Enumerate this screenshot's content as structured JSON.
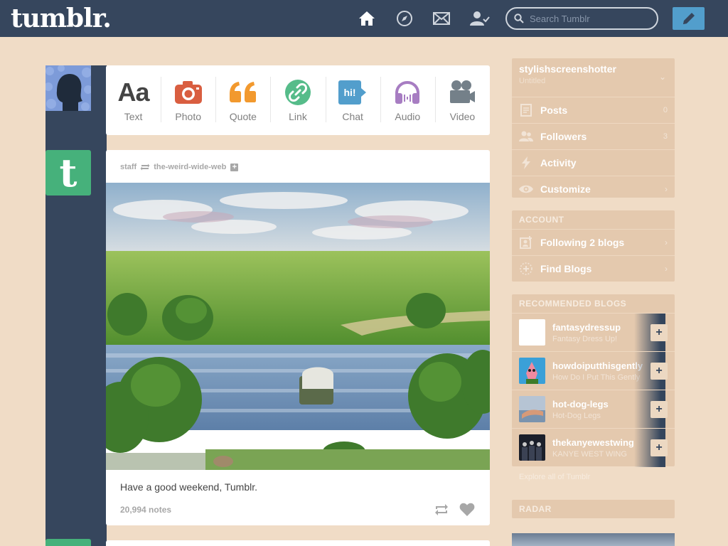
{
  "header": {
    "logo": "tumblr.",
    "search_placeholder": "Search Tumblr",
    "nav": [
      "home-icon",
      "explore-compass-icon",
      "inbox-envelope-icon",
      "account-icon"
    ],
    "compose_icon": "pencil-icon",
    "bg_color": "#36465d",
    "compose_color": "#529ecc"
  },
  "post_types": [
    {
      "label": "Text",
      "glyph": "Aa",
      "color": "#444444"
    },
    {
      "label": "Photo",
      "color": "#d95e40"
    },
    {
      "label": "Quote",
      "glyph": "“",
      "color": "#f2992e"
    },
    {
      "label": "Link",
      "color": "#56bc8a"
    },
    {
      "label": "Chat",
      "glyph": "hi!",
      "color": "#529ecc"
    },
    {
      "label": "Audio",
      "color": "#a77dc2"
    },
    {
      "label": "Video",
      "color": "#748089"
    }
  ],
  "post": {
    "author": "staff",
    "reblogged_from": "the-weird-wide-web",
    "caption": "Have a good weekend, Tumblr.",
    "notes": "20,994 notes"
  },
  "sidebar": {
    "account": {
      "name": "stylishscreenshotter",
      "subtitle": "Untitled"
    },
    "blog_rows": [
      {
        "label": "Posts",
        "count": "0",
        "icon": "posts-icon"
      },
      {
        "label": "Followers",
        "count": "3",
        "icon": "followers-icon"
      },
      {
        "label": "Activity",
        "count": "",
        "icon": "activity-bolt-icon"
      },
      {
        "label": "Customize",
        "count": "",
        "icon": "customize-eye-icon"
      }
    ],
    "account_section_title": "ACCOUNT",
    "account_rows": [
      {
        "label": "Following 2 blogs",
        "icon": "following-icon"
      },
      {
        "label": "Find Blogs",
        "icon": "find-blogs-icon"
      }
    ],
    "recommended_title": "RECOMMENDED BLOGS",
    "recommended": [
      {
        "name": "fantasydressup",
        "desc": "Fantasy Dress Up!"
      },
      {
        "name": "howdoiputthisgently",
        "desc": "How Do I Put This Gently"
      },
      {
        "name": "hot-dog-legs",
        "desc": "Hot-Dog Legs"
      },
      {
        "name": "thekanyewestwing",
        "desc": "KANYE WEST WING"
      }
    ],
    "explore": "Explore all of Tumblr",
    "radar_title": "RADAR"
  },
  "colors": {
    "page_bg": "#f0dcc6",
    "sidebar_block": "#e4c9ae",
    "staff_green": "#46b17b"
  }
}
